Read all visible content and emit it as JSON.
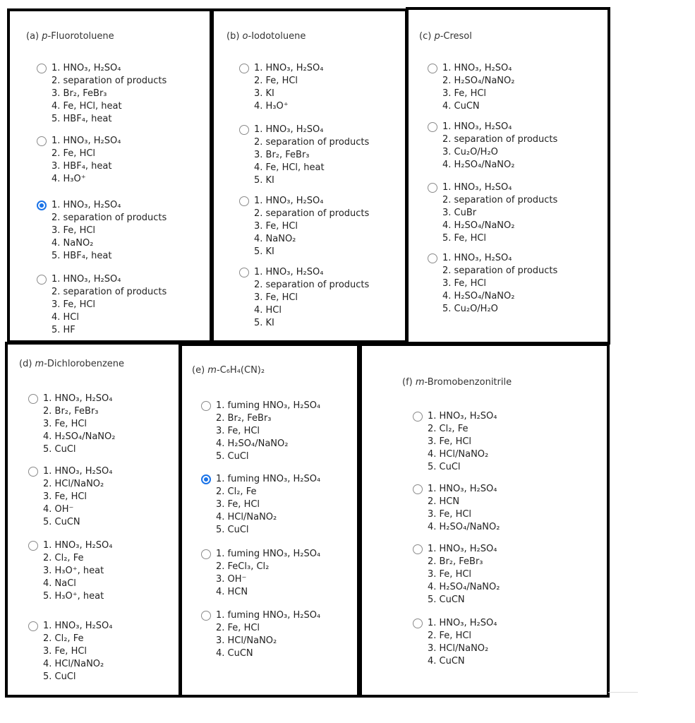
{
  "accent": "#1a73e8",
  "panels": [
    {
      "label": "(a) ",
      "compound_italic": "p",
      "compound_rest": "-Fluorotoluene",
      "selected": 2,
      "options": [
        [
          "1. HNO₃, H₂SO₄",
          "2. separation of products",
          "3. Br₂, FeBr₃",
          "4. Fe, HCl, heat",
          "5. HBF₄, heat"
        ],
        [
          "1. HNO₃, H₂SO₄",
          "2. Fe, HCl",
          "3. HBF₄, heat",
          "4. H₃O⁺"
        ],
        [
          "1. HNO₃, H₂SO₄",
          "2. separation of products",
          "3. Fe, HCl",
          "4. NaNO₂",
          "5. HBF₄, heat"
        ],
        [
          "1. HNO₃, H₂SO₄",
          "2. separation of products",
          "3. Fe, HCl",
          "4. HCl",
          "5. HF"
        ]
      ]
    },
    {
      "label": "(b) ",
      "compound_italic": "o",
      "compound_rest": "-Iodotoluene",
      "selected": null,
      "options": [
        [
          "1. HNO₃, H₂SO₄",
          "2. Fe, HCl",
          "3. KI",
          "4. H₃O⁺"
        ],
        [
          "1. HNO₃, H₂SO₄",
          "2. separation of products",
          "3. Br₂, FeBr₃",
          "4. Fe, HCl, heat",
          "5. KI"
        ],
        [
          "1. HNO₃, H₂SO₄",
          "2. separation of products",
          "3. Fe, HCl",
          "4. NaNO₂",
          "5. KI"
        ],
        [
          "1. HNO₃, H₂SO₄",
          "2. separation of products",
          "3. Fe, HCl",
          "4. HCl",
          "5. KI"
        ]
      ]
    },
    {
      "label": "(c) ",
      "compound_italic": "p",
      "compound_rest": "-Cresol",
      "selected": null,
      "options": [
        [
          "1. HNO₃, H₂SO₄",
          "2. H₂SO₄/NaNO₂",
          "3. Fe, HCl",
          "4. CuCN"
        ],
        [
          "1. HNO₃, H₂SO₄",
          "2. separation of products",
          "3. Cu₂O/H₂O",
          "4. H₂SO₄/NaNO₂"
        ],
        [
          "1. HNO₃, H₂SO₄",
          "2. separation of products",
          "3. CuBr",
          "4. H₂SO₄/NaNO₂",
          "5. Fe, HCl"
        ],
        [
          "1. HNO₃, H₂SO₄",
          "2. separation of products",
          "3. Fe, HCl",
          "4. H₂SO₄/NaNO₂",
          "5. Cu₂O/H₂O"
        ]
      ]
    },
    {
      "label": "(d) ",
      "compound_italic": "m",
      "compound_rest": "-Dichlorobenzene",
      "selected": null,
      "options": [
        [
          "1. HNO₃, H₂SO₄",
          "2. Br₂, FeBr₃",
          "3. Fe, HCl",
          "4. H₂SO₄/NaNO₂",
          "5. CuCl"
        ],
        [
          "1. HNO₃, H₂SO₄",
          "2. HCl/NaNO₂",
          "3. Fe, HCl",
          "4. OH⁻",
          "5. CuCN"
        ],
        [
          "1. HNO₃, H₂SO₄",
          "2. Cl₂, Fe",
          "3. H₃O⁺, heat",
          "4. NaCl",
          "5. H₃O⁺, heat"
        ],
        [
          "1. HNO₃, H₂SO₄",
          "2. Cl₂, Fe",
          "3. Fe, HCl",
          "4. HCl/NaNO₂",
          "5. CuCl"
        ]
      ]
    },
    {
      "label": "(e) ",
      "compound_italic": "m",
      "compound_rest": "-C₆H₄(CN)₂",
      "selected": 1,
      "options": [
        [
          "1. fuming HNO₃, H₂SO₄",
          "2. Br₂, FeBr₃",
          "3. Fe, HCl",
          "4. H₂SO₄/NaNO₂",
          "5. CuCl"
        ],
        [
          "1. fuming HNO₃, H₂SO₄",
          "2. Cl₂, Fe",
          "3. Fe, HCl",
          "4. HCl/NaNO₂",
          "5. CuCl"
        ],
        [
          "1. fuming HNO₃, H₂SO₄",
          "2. FeCl₃, Cl₂",
          "3. OH⁻",
          "4. HCN"
        ],
        [
          "1. fuming HNO₃, H₂SO₄",
          "2. Fe, HCl",
          "3. HCl/NaNO₂",
          "4. CuCN"
        ]
      ]
    },
    {
      "label": "(f) ",
      "compound_italic": "m",
      "compound_rest": "-Bromobenzonitrile",
      "selected": null,
      "options": [
        [
          "1. HNO₃, H₂SO₄",
          "2. Cl₂, Fe",
          "3. Fe, HCl",
          "4. HCl/NaNO₂",
          "5. CuCl"
        ],
        [
          "1. HNO₃, H₂SO₄",
          "2. HCN",
          "3. Fe, HCl",
          "4. H₂SO₄/NaNO₂"
        ],
        [
          "1. HNO₃, H₂SO₄",
          "2. Br₂, FeBr₃",
          "3. Fe, HCl",
          "4. H₂SO₄/NaNO₂",
          "5. CuCN"
        ],
        [
          "1. HNO₃, H₂SO₄",
          "2. Fe, HCl",
          "3. HCl/NaNO₂",
          "4. CuCN"
        ]
      ]
    }
  ]
}
